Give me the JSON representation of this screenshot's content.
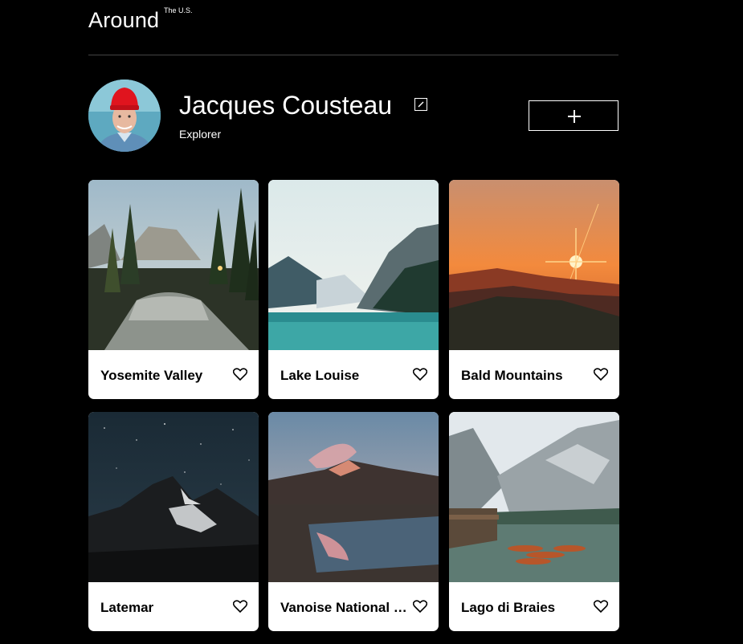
{
  "header": {
    "logo_text": "Around",
    "logo_superscript": "The U.S."
  },
  "profile": {
    "name": "Jacques Cousteau",
    "about": "Explorer",
    "avatar_icon": "portrait-red-cap",
    "edit_icon": "pencil-icon",
    "add_icon": "plus-icon"
  },
  "cards": [
    {
      "title": "Yosemite Valley",
      "scene": "forest-valley-river",
      "like_icon": "heart-outline-icon"
    },
    {
      "title": "Lake Louise",
      "scene": "turquoise-mountain-lake",
      "like_icon": "heart-outline-icon"
    },
    {
      "title": "Bald Mountains",
      "scene": "sunset-mountain-ridges",
      "like_icon": "heart-outline-icon"
    },
    {
      "title": "Latemar",
      "scene": "starry-night-peaks",
      "like_icon": "heart-outline-icon"
    },
    {
      "title": "Vanoise National Park",
      "scene": "dusk-mountain-lake-reflection",
      "like_icon": "heart-outline-icon"
    },
    {
      "title": "Lago di Braies",
      "scene": "alpine-lake-with-boats",
      "like_icon": "heart-outline-icon"
    }
  ],
  "colors": {
    "background": "#000000",
    "card_background": "#ffffff",
    "text_primary": "#ffffff",
    "card_text": "#000000",
    "divider": "#444444"
  }
}
